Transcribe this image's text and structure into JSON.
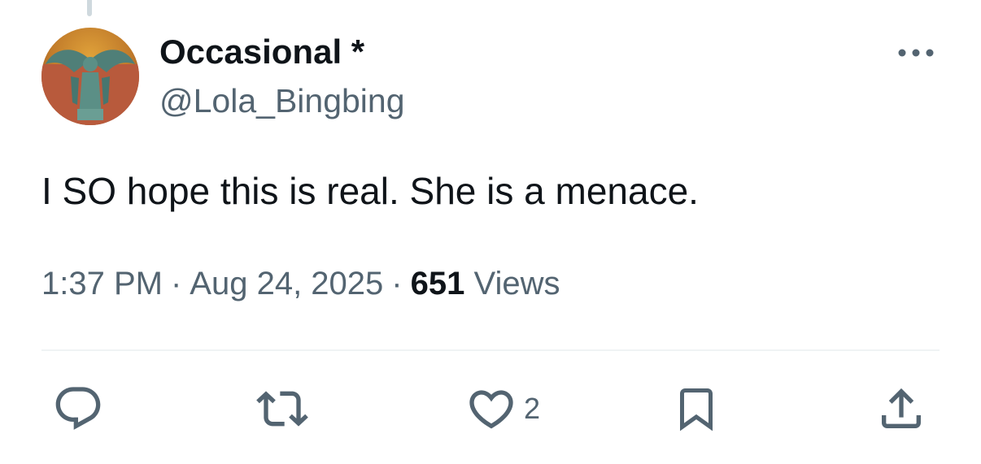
{
  "tweet": {
    "author": {
      "display_name": "Occasional *",
      "handle": "@Lola_Bingbing"
    },
    "text": "I SO hope this is real. She is a menace.",
    "time": "1:37 PM",
    "separator": "·",
    "date": "Aug 24, 2025",
    "views_count": "651",
    "views_label": "Views"
  },
  "actions": {
    "reply": {
      "icon": "reply-icon"
    },
    "retweet": {
      "icon": "retweet-icon"
    },
    "like": {
      "icon": "heart-icon",
      "count": "2"
    },
    "bookmark": {
      "icon": "bookmark-icon"
    },
    "share": {
      "icon": "share-icon"
    }
  },
  "colors": {
    "text_primary": "#0f1419",
    "text_secondary": "#536471",
    "divider": "#eff3f4"
  }
}
